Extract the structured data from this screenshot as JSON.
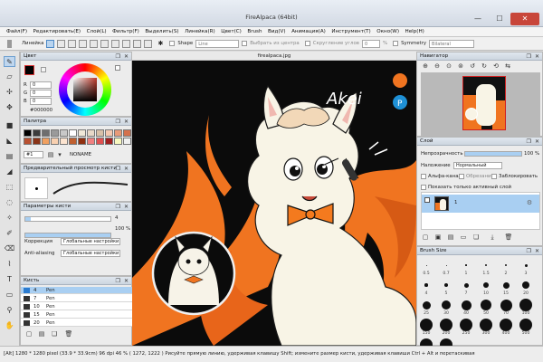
{
  "window": {
    "title": "FireAlpaca (64bit)",
    "minimize": "—",
    "maximize": "☐",
    "close": "✕"
  },
  "menu": [
    "Файл(F)",
    "Редактировать(E)",
    "Слой(L)",
    "Фильтр(F)",
    "Выделить(S)",
    "Линейка(R)",
    "Цвет(C)",
    "Brush",
    "Вид(V)",
    "Анимация(A)",
    "Инструмент(T)",
    "Окно(W)",
    "Help(H)"
  ],
  "toolbar": {
    "ruler_label": "Линейка",
    "shape_label": "Shape",
    "shape_value": "Line",
    "center_label": "Выбрать из центра",
    "round_label": "Скругление углов",
    "round_value": "0",
    "percent": "%",
    "symmetry_label": "Symmetry",
    "symmetry_value": "Bilateral"
  },
  "color_panel": {
    "title": "Цвет",
    "channels": [
      {
        "label": "R",
        "value": "0"
      },
      {
        "label": "G",
        "value": "0"
      },
      {
        "label": "B",
        "value": "0"
      }
    ],
    "hex": "#000000",
    "primary_color": "#000000",
    "secondary_color": "#ffffff"
  },
  "palette_panel": {
    "title": "Палитра",
    "swatches": [
      "#000000",
      "#3c3c3c",
      "#6e6e6e",
      "#9a9a9a",
      "#c8c8c8",
      "#ffffff",
      "#f0e8d8",
      "#e8d8c8",
      "#d8c0a8",
      "#f4c8b0",
      "#e89a78",
      "#d4704c",
      "#b85030",
      "#8a3418",
      "#f0a060",
      "#f8d0b0",
      "#fce4d0",
      "#c06030",
      "#903010",
      "#f08080",
      "#e05050",
      "#a02020",
      "#f8f8c0",
      "#f0f0f0"
    ],
    "selector_value": "#1",
    "noname": "NONAME"
  },
  "preview_panel": {
    "title": "Предварительный просмотр кисти"
  },
  "brush_params_panel": {
    "title": "Параметры кисти",
    "size_value": "4",
    "opacity_value": "100 %",
    "opacity_fraction": 1.0,
    "correction_label": "Коррекция",
    "correction_value": "Глобальные настройки",
    "antialias_label": "Anti-aliasing",
    "antialias_value": "Глобальные настройки"
  },
  "brush_panel": {
    "title": "Кисть",
    "items": [
      {
        "size": "4",
        "name": "Pen",
        "selected": true
      },
      {
        "size": "7",
        "name": "Pen",
        "selected": false
      },
      {
        "size": "10",
        "name": "Pen",
        "selected": false
      },
      {
        "size": "15",
        "name": "Pen",
        "selected": false
      },
      {
        "size": "20",
        "name": "Pen",
        "selected": false
      }
    ]
  },
  "canvas": {
    "filename": "firealpaca.jpg"
  },
  "navigator_panel": {
    "title": "Навигатор"
  },
  "layer_panel": {
    "title": "Слой",
    "opacity_label": "Непрозрачность",
    "opacity_value": "100 %",
    "opacity_fraction": 1.0,
    "blend_label": "Наложение",
    "blend_value": "Нормальный",
    "alpha_label": "Альфа-канал",
    "clip_label": "Обрезание",
    "lock_label": "Заблокировать",
    "only_active_label": "Показать только активный слой",
    "layers": [
      {
        "name": "1"
      }
    ]
  },
  "brush_size_panel": {
    "title": "Brush Size",
    "labels": [
      "0.5",
      "0.7",
      "1",
      "1.5",
      "2",
      "3",
      "4",
      "5",
      "7",
      "10",
      "15",
      "20",
      "25",
      "30",
      "40",
      "50",
      "70",
      "100",
      "150",
      "200",
      "250",
      "300",
      "400",
      "500",
      "700",
      "1000"
    ]
  },
  "status": {
    "text": "[Alt]  1280 * 1280 pixel  (33.9 * 33.9cm)  96 dpi  46 %  ( 1272, 1222 )  Рисуйте прямую линию, удерживая клавишу Shift; измените размер кисти, удерживая клавиши Ctrl + Alt и перетаскивая"
  },
  "art": {
    "signature": "Akei"
  }
}
